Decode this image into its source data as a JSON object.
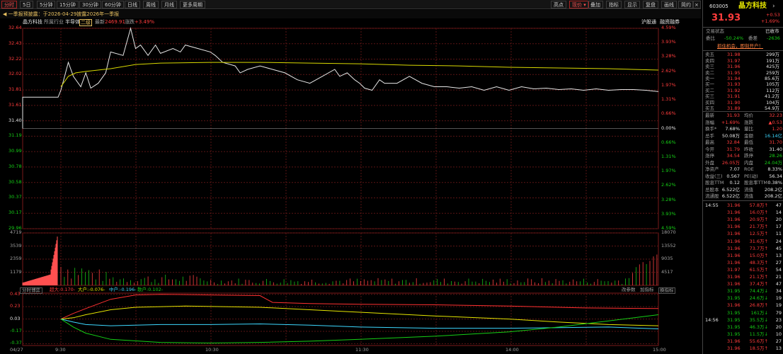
{
  "toolbar": {
    "tabs": [
      "分时",
      "5日",
      "5分钟",
      "15分钟",
      "30分钟",
      "60分钟",
      "日线",
      "周线",
      "月线",
      "更多周期"
    ],
    "active_tab": "分时",
    "right": [
      "叠加",
      "指标",
      "显示",
      "复盘",
      "画线",
      "简约"
    ],
    "quote_label": "高点",
    "price_select": "现价",
    "window_buttons": [
      "□",
      "×"
    ]
  },
  "notice": "一季报预披露：于2026-04-29披露2026年一季报",
  "infobar": {
    "name": "晶方科技",
    "industry_label": "所属行业",
    "industry": "半导体",
    "badge": "二级",
    "latest_label": "最新",
    "latest": "2469.91",
    "change_label": "涨跌",
    "change": "+3.49%",
    "links": [
      "沪股通",
      "融资融券"
    ]
  },
  "chart_data": [
    {
      "type": "line",
      "title": "",
      "y_left_ticks": [
        "32.64",
        "32.43",
        "32.22",
        "32.02",
        "31.81",
        "31.61",
        "31.40",
        "31.19",
        "30.99",
        "30.78",
        "30.58",
        "30.37",
        "30.17",
        "29.96"
      ],
      "y_right_ticks": [
        "4.59%",
        "3.93%",
        "3.28%",
        "2.62%",
        "1.97%",
        "1.31%",
        "0.66%",
        "0.00%",
        "0.66%",
        "1.31%",
        "1.97%",
        "2.62%",
        "3.28%",
        "3.93%",
        "4.59%"
      ],
      "x_ticks": [
        "04/27",
        "9:30",
        "10:30",
        "11:30",
        "14:00",
        "15:00"
      ],
      "ylim": [
        29.96,
        32.84
      ],
      "prev_close": 31.4,
      "series": [
        {
          "role": "price",
          "x": [
            0,
            3,
            5,
            8,
            10,
            12,
            15,
            18,
            20,
            25,
            28,
            30,
            32,
            35,
            38,
            40,
            45,
            48,
            50,
            55,
            60,
            62,
            65,
            70,
            72,
            75,
            80,
            85,
            90,
            95,
            100,
            105,
            110,
            112,
            115,
            118,
            120,
            122,
            125,
            128,
            130,
            135,
            140,
            145,
            150,
            155,
            160,
            165,
            170,
            175,
            180,
            185,
            190,
            195,
            200,
            205,
            210,
            215,
            220,
            225,
            230,
            235,
            240
          ],
          "values": [
            31.95,
            32.35,
            32.15,
            32.0,
            32.2,
            31.98,
            32.05,
            32.2,
            32.5,
            32.45,
            32.84,
            32.55,
            32.6,
            32.45,
            32.6,
            32.48,
            32.55,
            32.5,
            32.6,
            32.55,
            32.5,
            32.45,
            32.35,
            32.3,
            32.2,
            32.25,
            32.3,
            32.25,
            32.2,
            32.1,
            32.05,
            32.15,
            32.25,
            32.15,
            32.2,
            32.1,
            32.05,
            31.98,
            31.95,
            32.1,
            32.05,
            32.05,
            32.15,
            32.05,
            32.0,
            32.0,
            31.98,
            32.0,
            31.95,
            32.0,
            31.95,
            32.0,
            31.97,
            31.98,
            31.96,
            31.97,
            31.95,
            31.97,
            31.95,
            31.96,
            31.96,
            31.95,
            31.93
          ]
        },
        {
          "role": "average",
          "x": [
            0,
            3,
            6,
            10,
            20,
            30,
            40,
            60,
            80,
            100,
            120,
            140,
            160,
            180,
            200,
            220,
            240
          ],
          "values": [
            32.0,
            32.15,
            32.2,
            32.22,
            32.26,
            32.32,
            32.34,
            32.35,
            32.35,
            32.34,
            32.33,
            32.31,
            32.3,
            32.28,
            32.27,
            32.26,
            32.24
          ]
        }
      ]
    },
    {
      "type": "bar",
      "title": "",
      "y_left_ticks": [
        "4719",
        "3539",
        "2359",
        "1179"
      ],
      "y_right_ticks": [
        "18070",
        "13552",
        "9035",
        "4517"
      ],
      "ylim": [
        0,
        4719
      ],
      "note": "volume bars, red=up green=down"
    },
    {
      "type": "line",
      "title": "",
      "labels": {
        "tab": "分时博弈",
        "super": "超大:0.170-",
        "large": "大户:-0.076-",
        "mid": "中户:-0.196-",
        "retail": "散户:0.102-"
      },
      "buttons": [
        "改参数",
        "加指标",
        "换指标"
      ],
      "y_ticks": [
        "0.43",
        "0.23",
        "0.03",
        "-0.17",
        "-0.37"
      ],
      "ylim": [
        -0.4,
        0.45
      ],
      "series": [
        {
          "role": "super",
          "color": "#ff3030",
          "x": [
            0,
            5,
            10,
            20,
            30,
            40,
            60,
            80,
            85,
            100,
            120,
            150,
            180,
            210,
            240
          ],
          "values": [
            0.03,
            0.12,
            0.2,
            0.35,
            0.42,
            0.43,
            0.42,
            0.41,
            0.3,
            0.28,
            0.27,
            0.26,
            0.24,
            0.21,
            0.2
          ]
        },
        {
          "role": "large",
          "color": "#e6e600",
          "x": [
            0,
            5,
            10,
            20,
            30,
            50,
            80,
            100,
            120,
            150,
            180,
            200,
            220,
            240
          ],
          "values": [
            0.03,
            0.05,
            0.1,
            0.18,
            0.22,
            0.24,
            0.22,
            0.18,
            0.14,
            0.08,
            0.03,
            -0.02,
            -0.06,
            -0.08
          ]
        },
        {
          "role": "mid",
          "color": "#3cd8ff",
          "x": [
            0,
            5,
            10,
            20,
            40,
            60,
            80,
            100,
            120,
            150,
            180,
            200,
            220,
            240
          ],
          "values": [
            0.03,
            -0.02,
            -0.06,
            -0.08,
            -0.06,
            -0.06,
            -0.05,
            -0.07,
            -0.1,
            -0.12,
            -0.12,
            -0.11,
            -0.1,
            -0.13
          ]
        },
        {
          "role": "retail",
          "color": "#16d016",
          "x": [
            0,
            5,
            10,
            20,
            40,
            60,
            80,
            100,
            120,
            150,
            180,
            200,
            220,
            240
          ],
          "values": [
            0.03,
            -0.1,
            -0.2,
            -0.3,
            -0.35,
            -0.36,
            -0.35,
            -0.33,
            -0.3,
            -0.25,
            -0.18,
            -0.1,
            0.0,
            0.1
          ]
        }
      ]
    }
  ],
  "side": {
    "code": "603005",
    "name": "晶方科技",
    "price": "31.93",
    "chg": "+0.53",
    "pct": "+1.69%",
    "status_label": "交易状态",
    "status_value": "已收市",
    "ratio_label": "委比",
    "ratio_value": "-50.24%",
    "diff_label": "委差",
    "diff_value": "-2636",
    "promo": "抓住机会，即刻开户！",
    "asks": [
      {
        "label": "卖五",
        "price": "31.98",
        "vol": "299万"
      },
      {
        "label": "卖四",
        "price": "31.97",
        "vol": "191万"
      },
      {
        "label": "卖三",
        "price": "31.96",
        "vol": "425万"
      },
      {
        "label": "卖二",
        "price": "31.95",
        "vol": "259万"
      },
      {
        "label": "卖一",
        "price": "31.94",
        "vol": "85.6万"
      }
    ],
    "bids": [
      {
        "label": "买一",
        "price": "31.93",
        "vol": "105万"
      },
      {
        "label": "买二",
        "price": "31.92",
        "vol": "112万"
      },
      {
        "label": "买三",
        "price": "31.91",
        "vol": "41.2万"
      },
      {
        "label": "买四",
        "price": "31.90",
        "vol": "104万"
      },
      {
        "label": "买五",
        "price": "31.89",
        "vol": "54.9万"
      }
    ],
    "stats": [
      {
        "l1": "最新",
        "v1": "31.93",
        "c1": "red",
        "l2": "均价",
        "v2": "32.23",
        "c2": "red"
      },
      {
        "l1": "涨幅",
        "v1": "+1.69%",
        "c1": "red",
        "l2": "涨跌",
        "v2": "▲0.53",
        "c2": "red"
      },
      {
        "l1": "换手*",
        "v1": "7.68%",
        "c1": "white",
        "l2": "量比",
        "v2": "1.20",
        "c2": "red"
      },
      {
        "l1": "总手",
        "v1": "50.08万",
        "c1": "white",
        "l2": "金额",
        "v2": "16.14亿",
        "c2": "cyan"
      },
      {
        "l1": "最高",
        "v1": "32.84",
        "c1": "red",
        "l2": "最低",
        "v2": "31.70",
        "c2": "red"
      },
      {
        "l1": "今开",
        "v1": "31.79",
        "c1": "red",
        "l2": "昨收",
        "v2": "31.40",
        "c2": "white"
      },
      {
        "l1": "涨停",
        "v1": "34.54",
        "c1": "red",
        "l2": "跌停",
        "v2": "28.26",
        "c2": "green"
      },
      {
        "l1": "外盘",
        "v1": "26.05万",
        "c1": "red",
        "l2": "内盘",
        "v2": "24.04万",
        "c2": "green"
      },
      {
        "l1": "净资产",
        "v1": "7.07",
        "c1": "white",
        "l2": "ROE",
        "v2": "8.33%",
        "c2": "white"
      },
      {
        "l1": "收益(三)",
        "v1": "0.567",
        "c1": "white",
        "l2": "PE(动)",
        "v2": "56.34",
        "c2": "white"
      },
      {
        "l1": "股息TTM",
        "v1": "0.12",
        "c1": "white",
        "l2": "股息率TTM",
        "v2": "0.38%",
        "c2": "white"
      },
      {
        "l1": "总股本",
        "v1": "6.522亿",
        "c1": "white",
        "l2": "流值",
        "v2": "208.2亿",
        "c2": "white"
      },
      {
        "l1": "流通股",
        "v1": "6.522亿",
        "c1": "white",
        "l2": "流值",
        "v2": "208.2亿",
        "c2": "white"
      }
    ],
    "ticks": [
      {
        "t": "14:55",
        "p": "31.96",
        "v": "57.8万",
        "d": "up",
        "n": "47"
      },
      {
        "t": "",
        "p": "31.96",
        "v": "16.0万",
        "d": "up",
        "n": "14"
      },
      {
        "t": "",
        "p": "31.96",
        "v": "20.9万",
        "d": "up",
        "n": "20"
      },
      {
        "t": "",
        "p": "31.96",
        "v": "21.7万",
        "d": "up",
        "n": "17"
      },
      {
        "t": "",
        "p": "31.96",
        "v": "12.5万",
        "d": "up",
        "n": "11"
      },
      {
        "t": "",
        "p": "31.96",
        "v": "31.6万",
        "d": "up",
        "n": "24"
      },
      {
        "t": "",
        "p": "31.96",
        "v": "73.7万",
        "d": "up",
        "n": "45"
      },
      {
        "t": "",
        "p": "31.96",
        "v": "15.0万",
        "d": "up",
        "n": "13"
      },
      {
        "t": "",
        "p": "31.96",
        "v": "48.3万",
        "d": "up",
        "n": "27"
      },
      {
        "t": "",
        "p": "31.97",
        "v": "61.5万",
        "d": "up",
        "n": "54"
      },
      {
        "t": "",
        "p": "31.96",
        "v": "21.1万",
        "d": "up",
        "n": "21"
      },
      {
        "t": "",
        "p": "31.96",
        "v": "37.4万",
        "d": "up",
        "n": "47"
      },
      {
        "t": "",
        "p": "31.95",
        "v": "74.4万",
        "d": "down",
        "n": "34"
      },
      {
        "t": "",
        "p": "31.95",
        "v": "24.6万",
        "d": "down",
        "n": "19"
      },
      {
        "t": "",
        "p": "31.96",
        "v": "26.8万",
        "d": "up",
        "n": "19"
      },
      {
        "t": "",
        "p": "31.95",
        "v": "161万",
        "d": "down",
        "n": "79"
      },
      {
        "t": "14:56",
        "p": "31.95",
        "v": "35.5万",
        "d": "down",
        "n": "23"
      },
      {
        "t": "",
        "p": "31.95",
        "v": "46.3万",
        "d": "down",
        "n": "20"
      },
      {
        "t": "",
        "p": "31.95",
        "v": "11.5万",
        "d": "down",
        "n": "10"
      },
      {
        "t": "",
        "p": "31.96",
        "v": "55.6万",
        "d": "up",
        "n": "27"
      },
      {
        "t": "",
        "p": "31.96",
        "v": "18.5万",
        "d": "up",
        "n": "13"
      }
    ]
  }
}
